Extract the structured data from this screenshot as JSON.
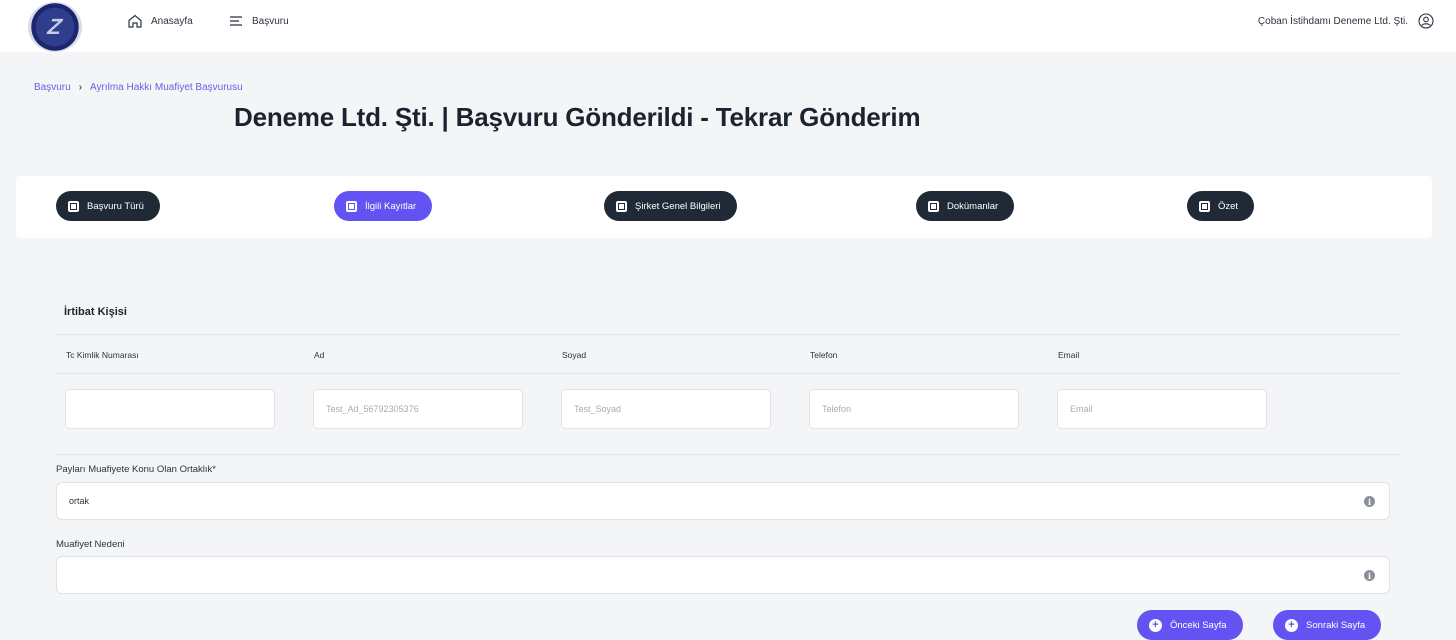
{
  "header": {
    "home_label": "Anasayfa",
    "apply_label": "Başvuru",
    "user_label": "Çoban İstihdamı Deneme Ltd. Şti."
  },
  "breadcrumb": {
    "items": [
      "Başvuru",
      "Ayrılma Hakkı Muafiyet Başvurusu"
    ]
  },
  "page_title": "Deneme Ltd. Şti. | Başvuru Gönderildi - Tekrar Gönderim",
  "steps": [
    {
      "label": "Başvuru Türü",
      "active": false
    },
    {
      "label": "İlgili Kayıtlar",
      "active": true
    },
    {
      "label": "Şirket Genel Bilgileri",
      "active": false
    },
    {
      "label": "Dokümanlar",
      "active": false
    },
    {
      "label": "Özet",
      "active": false
    }
  ],
  "contact": {
    "section_title": "İrtibat Kişisi",
    "columns": [
      "Tc Kimlik Numarası",
      "Ad",
      "Soyad",
      "Telefon",
      "Email"
    ],
    "placeholders": [
      "",
      "Test_Ad_56792305376",
      "Test_Soyad",
      "Telefon",
      "Email"
    ]
  },
  "partnership": {
    "label": "Payları Muafiyete Konu Olan Ortaklık*",
    "value": "ortak"
  },
  "reason": {
    "label": "Muafiyet Nedeni",
    "value": ""
  },
  "buttons": {
    "prev": "Önceki Sayfa",
    "next": "Sonraki Sayfa"
  },
  "colors": {
    "accent": "#6353f2",
    "dark_step": "#1f2a36",
    "breadcrumb": "#6a5fe7"
  }
}
